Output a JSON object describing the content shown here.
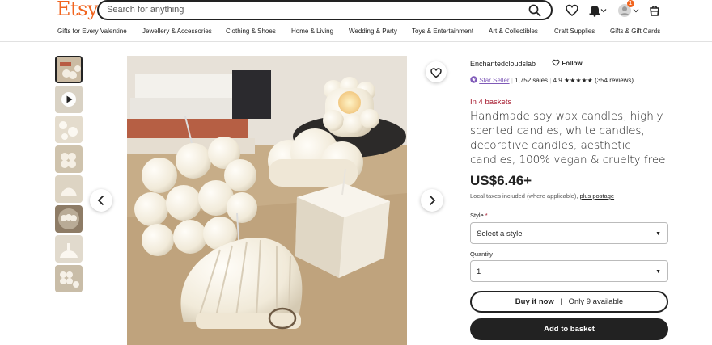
{
  "header": {
    "logo": "Etsy",
    "search_placeholder": "Search for anything",
    "cart_count": "1",
    "icons": [
      "search-icon",
      "heart-icon",
      "bell-icon",
      "avatar-icon",
      "cart-icon"
    ]
  },
  "nav": {
    "items": [
      "Gifts for Every Valentine",
      "Jewellery & Accessories",
      "Clothing & Shoes",
      "Home & Living",
      "Wedding & Party",
      "Toys & Entertainment",
      "Art & Collectibles",
      "Craft Supplies",
      "Gifts & Gift Cards"
    ]
  },
  "gallery": {
    "thumbnail_count": 8,
    "video_thumbnail_index": 1
  },
  "product": {
    "shop_name": "Enchantedcloudslab",
    "follow_label": "Follow",
    "star_seller_label": "Star Seller",
    "sales": "1,752 sales",
    "rating": "4.9",
    "stars": "★★★★★",
    "reviews": "(354 reviews)",
    "baskets": "In 4 baskets",
    "title": "Handmade soy wax candles, highly scented candles, white candles, decorative candles, aesthetic candles, 100% vegan & cruelty free.",
    "price": "US$6.46+",
    "tax_text": "Local taxes included (where applicable),",
    "postage_link": "plus postage",
    "style_label": "Style",
    "required_mark": "*",
    "style_value": "Select a style",
    "quantity_label": "Quantity",
    "quantity_value": "1",
    "buy_now_label": "Buy it now",
    "separator": "|",
    "available_label": "Only 9 available",
    "add_to_cart_label": "Add to basket"
  },
  "colors": {
    "brand": "#f1641e",
    "basket_red": "#a61a2e",
    "star_seller_purple": "#7f5ab8",
    "dark": "#222222"
  }
}
